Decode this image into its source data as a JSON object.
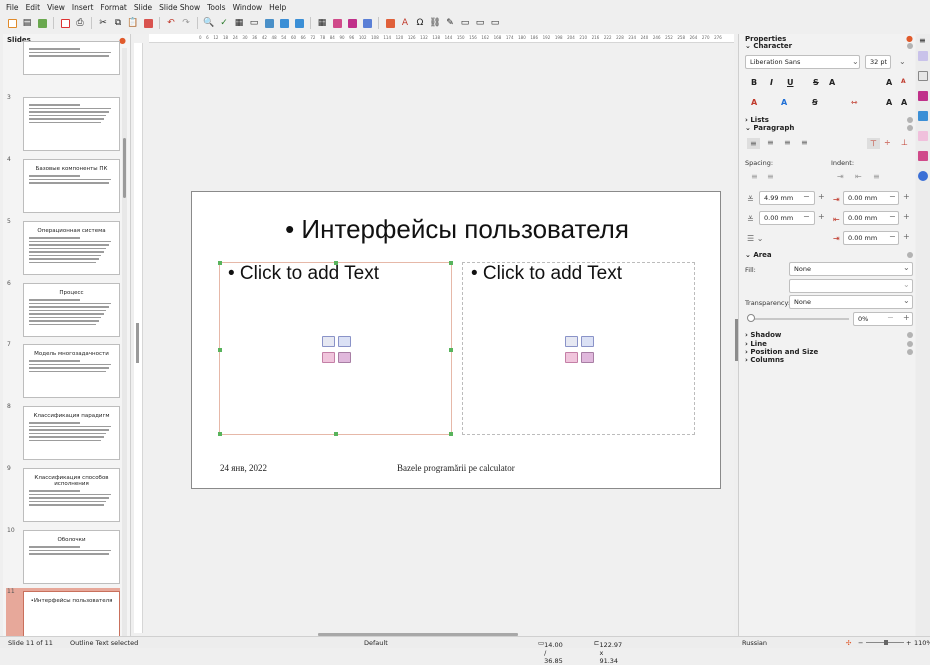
{
  "menu": [
    "File",
    "Edit",
    "View",
    "Insert",
    "Format",
    "Slide",
    "Slide Show",
    "Tools",
    "Window",
    "Help"
  ],
  "slides_pane": {
    "title": "Slides",
    "thumbs": [
      {
        "num": "",
        "title": "",
        "lines": 3
      },
      {
        "num": "3",
        "title": "",
        "lines": 6
      },
      {
        "num": "4",
        "title": "Базовые компоненты ПК",
        "lines": 3
      },
      {
        "num": "5",
        "title": "Операционная система",
        "lines": 8
      },
      {
        "num": "6",
        "title": "Процесс",
        "lines": 8
      },
      {
        "num": "7",
        "title": "Модель многозадачности",
        "lines": 4
      },
      {
        "num": "8",
        "title": "Классификация парадигм",
        "lines": 6
      },
      {
        "num": "9",
        "title": "Классификация способов исполнения",
        "lines": 5
      },
      {
        "num": "10",
        "title": "Оболочки",
        "lines": 3
      },
      {
        "num": "11",
        "title": "•Интерфейсы пользователя",
        "lines": 0
      }
    ]
  },
  "slide": {
    "title": "• Интерфейсы пользователя",
    "left_placeholder": "• Click to add Text",
    "right_placeholder": "• Click to add Text",
    "footer_date": "24 янв, 2022",
    "footer_center": "Bazele programării pe calculator"
  },
  "sidebar": {
    "properties": "Properties",
    "character": "Character",
    "font_name": "Liberation Sans",
    "font_size": "32 pt",
    "lists": "Lists",
    "paragraph": "Paragraph",
    "spacing": "Spacing:",
    "indent": "Indent:",
    "spacing_above": "4.99 mm",
    "spacing_below": "0.00 mm",
    "indent_before": "0.00 mm",
    "indent_after": "0.00 mm",
    "indent_first": "0.00 mm",
    "area": "Area",
    "fill_label": "Fill:",
    "fill_value": "None",
    "transparency_label": "Transparency:",
    "transparency_value": "None",
    "transparency_pct": "0%",
    "shadow": "Shadow",
    "line": "Line",
    "position_size": "Position and Size",
    "columns": "Columns"
  },
  "status": {
    "slide_info": "Slide 11 of 11",
    "selection": "Outline Text selected",
    "layout": "Default",
    "position": "14.00 / 36.85",
    "size": "122.97 x 91.34",
    "language": "Russian",
    "zoom": "110%"
  },
  "colors": {
    "accent": "#e05a2b",
    "selection": "#e7a89a",
    "handle": "#58b35c"
  }
}
